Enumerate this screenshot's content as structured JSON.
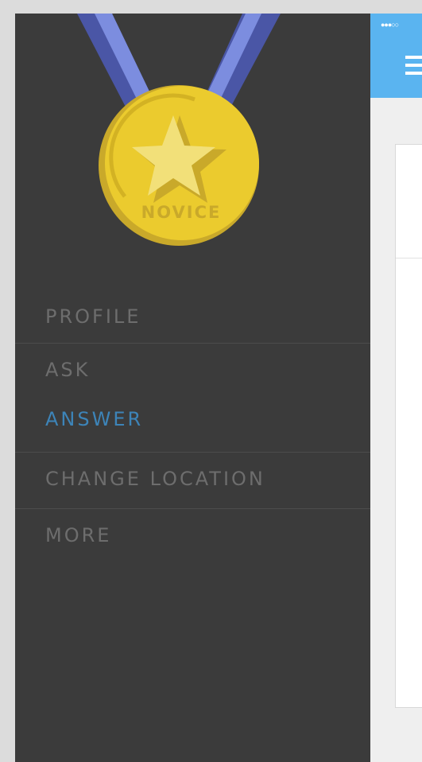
{
  "status_bar": {
    "signal_dots": "●●●○○"
  },
  "badge": {
    "level_text": "NOVICE"
  },
  "menu": {
    "items": [
      {
        "label": "PROFILE"
      },
      {
        "label": "ASK"
      },
      {
        "label": "ANSWER"
      },
      {
        "label": "CHANGE LOCATION"
      },
      {
        "label": "MORE"
      }
    ],
    "active_item": "ANSWER"
  },
  "colors": {
    "drawer_bg": "#3b3b3b",
    "menu_text": "#6d6d6d",
    "menu_active": "#3d84b8",
    "topbar": "#5ab4f0",
    "medal_gold": "#ebcb2e",
    "ribbon_dark": "#4a56a6",
    "ribbon_light": "#7c8ddf"
  },
  "icons": {
    "medal": "medal-star-icon",
    "menu": "hamburger-icon",
    "signal": "signal-strength-icon"
  }
}
